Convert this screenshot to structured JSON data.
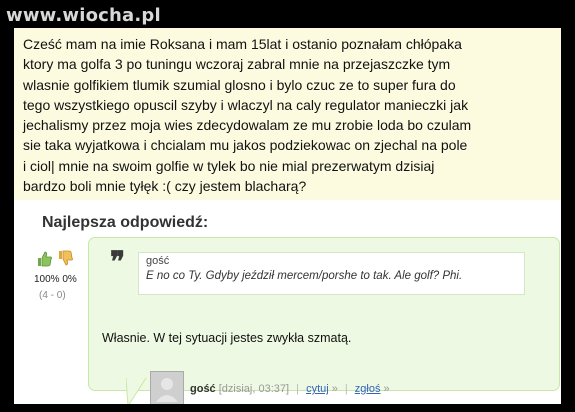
{
  "watermark": "www.wiocha.pl",
  "question": {
    "lines": [
      "Cześć mam na imie Roksana i mam 15lat i ostanio poznałam chłópaka",
      "ktory ma golfa 3 po tuningu wczoraj zabral mnie na przejaszczke tym",
      "wlasnie golfikiem tlumik szumial glosno i bylo czuc ze to super fura do",
      "tego wszystkiego opuscil szyby i wlaczyl na caly regulator manieczki jak",
      "jechalismy przez moja wies zdecydowalam ze mu zrobie loda bo czulam",
      "sie taka wyjatkowa i chcialam mu jakos podziekowac on zjechal na pole",
      "i ciol| mnie na swoim golfie w tylek bo nie mial prezerwatym dzisiaj",
      "bardzo boli mnie tyłęk :( czy jestem blacharą?"
    ]
  },
  "best_answer": {
    "title": "Najlepsza odpowiedź:",
    "rating_percent": "100% 0%",
    "rating_count": "(4 - 0)",
    "quote_mark": "❞",
    "quote_author": "gość",
    "quote_text": "E no co Ty. Gdyby jeździł mercem/porshe to tak. Ale golf? Phi.",
    "text": "Własnie. W tej sytuacji jestes zwykła szmatą.",
    "author": "gość",
    "date": "[dzisiaj, 03:37]",
    "separator": "|",
    "quote_link": "cytuj",
    "report_link": "zgłoś",
    "raquo": "»"
  },
  "colors": {
    "question_bg": "#fcfbe0",
    "answer_bg": "#eef9e3",
    "link": "#3366bb",
    "thumb_up": "#6fa84a",
    "thumb_down": "#e1a53a"
  },
  "icons": [
    "thumb-up-icon",
    "thumb-down-icon",
    "quote-icon",
    "avatar-icon"
  ]
}
